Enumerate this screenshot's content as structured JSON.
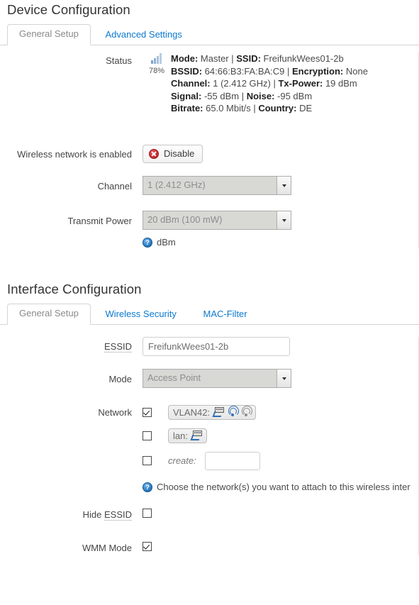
{
  "device": {
    "legend": "Device Configuration",
    "tabs": [
      {
        "label": "General Setup",
        "active": true
      },
      {
        "label": "Advanced Settings",
        "active": false
      }
    ],
    "status": {
      "label": "Status",
      "signal_percent": "78%",
      "signal_icon": "signal-bars-icon",
      "lines": [
        {
          "k1": "Mode:",
          "v1": " Master | ",
          "k2": "SSID:",
          "v2": " FreifunkWees01-2b"
        },
        {
          "k1": "BSSID:",
          "v1": " 64:66:B3:FA:BA:C9 | ",
          "k2": "Encryption:",
          "v2": " None"
        },
        {
          "k1": "Channel:",
          "v1": " 1 (2.412 GHz) | ",
          "k2": "Tx-Power:",
          "v2": " 19 dBm"
        },
        {
          "k1": "Signal:",
          "v1": " -55 dBm | ",
          "k2": "Noise:",
          "v2": " -95 dBm"
        },
        {
          "k1": "Bitrate:",
          "v1": " 65.0 Mbit/s | ",
          "k2": "Country:",
          "v2": " DE"
        }
      ]
    },
    "enabled_row": {
      "label": "Wireless network is enabled",
      "button_label": "Disable",
      "button_icon": "stop-icon"
    },
    "channel_row": {
      "label": "Channel",
      "value": "1 (2.412 GHz)"
    },
    "txpower_row": {
      "label": "Transmit Power",
      "value": "20 dBm (100 mW)",
      "hint": "dBm",
      "hint_icon": "help-icon"
    }
  },
  "interface": {
    "legend": "Interface Configuration",
    "tabs": [
      {
        "label": "General Setup",
        "active": true
      },
      {
        "label": "Wireless Security",
        "active": false
      },
      {
        "label": "MAC-Filter",
        "active": false
      }
    ],
    "essid_row": {
      "label": "ESSID",
      "value": "FreifunkWees01-2b"
    },
    "mode_row": {
      "label": "Mode",
      "value": "Access Point"
    },
    "network_row": {
      "label": "Network",
      "entries": [
        {
          "checked": true,
          "name": "VLAN42:",
          "icons": [
            "switch-icon",
            "access-point-icon-active",
            "access-point-icon-inactive"
          ]
        },
        {
          "checked": false,
          "name": "lan:",
          "icons": [
            "switch-icon"
          ]
        }
      ],
      "create": {
        "checked": false,
        "label": "create:",
        "value": ""
      },
      "hint": "Choose the network(s) you want to attach to this wireless inter",
      "hint_icon": "help-icon"
    },
    "hide_essid_row": {
      "label_prefix": "Hide ",
      "label_abbr": "ESSID",
      "checked": false
    },
    "wmm_row": {
      "label": "WMM Mode",
      "checked": true
    }
  },
  "colors": {
    "link": "#0b79d0",
    "heading": "#333333",
    "border": "#d4d4d4",
    "accent_blue": "#2f6fb5",
    "danger_red": "#c0272d"
  }
}
